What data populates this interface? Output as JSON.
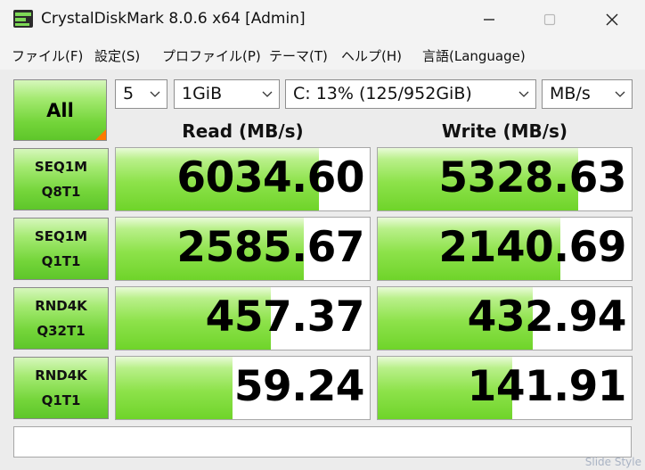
{
  "window": {
    "title": "CrystalDiskMark 8.0.6 x64 [Admin]",
    "icons": [
      "app-icon",
      "minimize-icon",
      "maximize-icon",
      "close-icon"
    ]
  },
  "menu": [
    "ファイル(F)",
    "設定(S)",
    "プロファイル(P)",
    "テーマ(T)",
    "ヘルプ(H)",
    "言語(Language)"
  ],
  "controls": {
    "all_label": "All",
    "count": "5",
    "size": "1GiB",
    "drive": "C: 13% (125/952GiB)",
    "unit": "MB/s"
  },
  "columns": {
    "read": "Read (MB/s)",
    "write": "Write (MB/s)"
  },
  "accent_colors": {
    "green": "#74d53a",
    "corner": "#ff7a00"
  },
  "tests": [
    {
      "line1": "SEQ1M",
      "line2": "Q8T1",
      "read": "6034.60",
      "write": "5328.63",
      "read_fill": 0.8,
      "write_fill": 0.79
    },
    {
      "line1": "SEQ1M",
      "line2": "Q1T1",
      "read": "2585.67",
      "write": "2140.69",
      "read_fill": 0.74,
      "write_fill": 0.72
    },
    {
      "line1": "RND4K",
      "line2": "Q32T1",
      "read": "457.37",
      "write": "432.94",
      "read_fill": 0.61,
      "write_fill": 0.61
    },
    {
      "line1": "RND4K",
      "line2": "Q1T1",
      "read": "59.24",
      "write": "141.91",
      "read_fill": 0.46,
      "write_fill": 0.53
    }
  ],
  "status": "",
  "watermark": "Slide Style"
}
